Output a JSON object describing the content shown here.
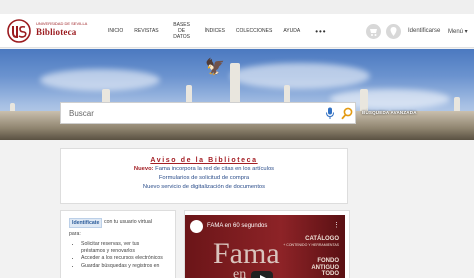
{
  "header": {
    "logo_text": "Biblioteca",
    "logo_sub": "UNIVERSIDAD DE SEVILLA",
    "nav": [
      "INICIO",
      "REVISTAS",
      "BASES DE DATOS",
      "ÍNDICES",
      "COLECCIONES",
      "AYUDA"
    ],
    "more": "•••",
    "login": "Identificarse",
    "menu": "Menú ▾",
    "icon1": "cart-icon",
    "icon2": "pin-icon"
  },
  "search": {
    "placeholder": "Buscar",
    "advanced": "BÚSQUEDA AVANZADA"
  },
  "notice": {
    "title": "Aviso de la Biblioteca",
    "line1_bold": "Nuevo:",
    "line1": " Fama incorpora la red de citas en los artículos",
    "line2": "Formularios de solicitud de compra",
    "line3": "Nuevo servicio de digitalización de documentos"
  },
  "card": {
    "identify": "Identifícate",
    "text1": "con tu usuario virtual",
    "text2": "para:",
    "items": [
      "Solicitar reservas, ver tus",
      "préstamos y renovarlos",
      "Acceder a los recursos electrónicos",
      "Guardar búsquedas y registros en"
    ]
  },
  "video": {
    "title": "FAMA en 60 segundos",
    "fama": "Fama",
    "en": "en",
    "catalogo": "CATÁLOGO",
    "catalogo_sub": "+ CONTENIDO Y HERRAMIENTAS",
    "fondo1": "FONDO",
    "fondo2": "ANTIGUO",
    "fondo3": "TODO"
  },
  "colors": {
    "brand": "#9b1b1f",
    "link": "#2b4d8a"
  }
}
